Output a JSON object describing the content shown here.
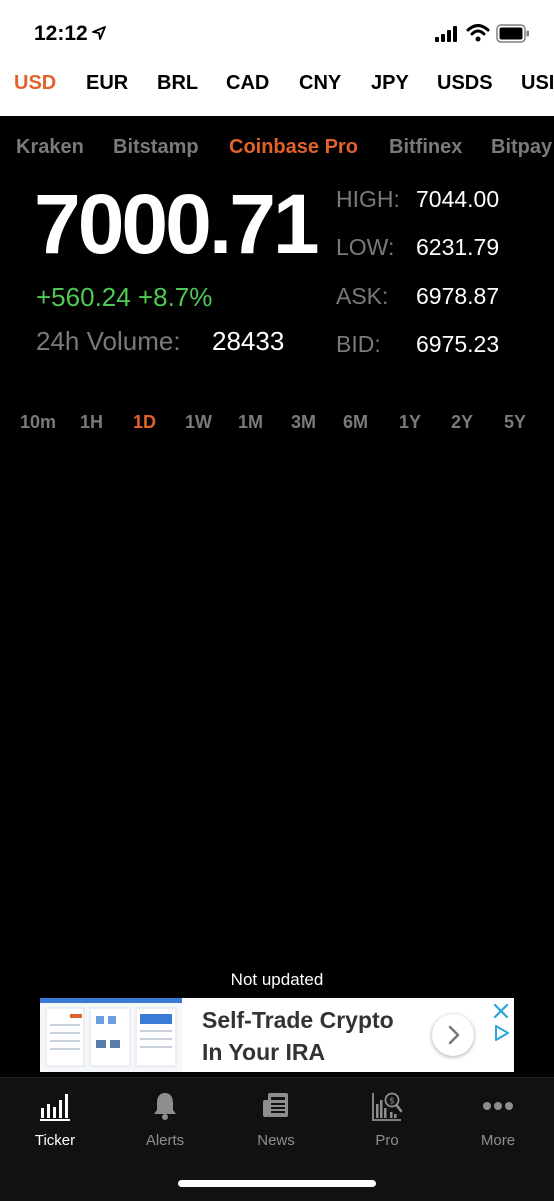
{
  "status_bar": {
    "time": "12:12"
  },
  "currencies": [
    "USD",
    "EUR",
    "BRL",
    "CAD",
    "CNY",
    "JPY",
    "USDS",
    "USI"
  ],
  "active_currency": "USD",
  "exchanges": [
    "Kraken",
    "Bitstamp",
    "Coinbase Pro",
    "Bitfinex",
    "Bitpay"
  ],
  "active_exchange": "Coinbase Pro",
  "ticker": {
    "price": "7000.71",
    "change": "+560.24 +8.7%",
    "volume_label": "24h Volume:",
    "volume_value": "28433"
  },
  "stats": {
    "high_label": "HIGH:",
    "high_value": "7044.00",
    "low_label": "LOW:",
    "low_value": "6231.79",
    "ask_label": "ASK:",
    "ask_value": "6978.87",
    "bid_label": "BID:",
    "bid_value": "6975.23"
  },
  "ranges": [
    "10m",
    "1H",
    "1D",
    "1W",
    "1M",
    "3M",
    "6M",
    "1Y",
    "2Y",
    "5Y"
  ],
  "active_range": "1D",
  "not_updated": "Not updated",
  "ad": {
    "line1": "Self-Trade Crypto",
    "line2": "In Your IRA"
  },
  "tabs": [
    "Ticker",
    "Alerts",
    "News",
    "Pro",
    "More"
  ],
  "active_tab": "Ticker",
  "colors": {
    "accent": "#e2622c",
    "positive": "#4fc955",
    "muted": "#7a7a7a"
  }
}
